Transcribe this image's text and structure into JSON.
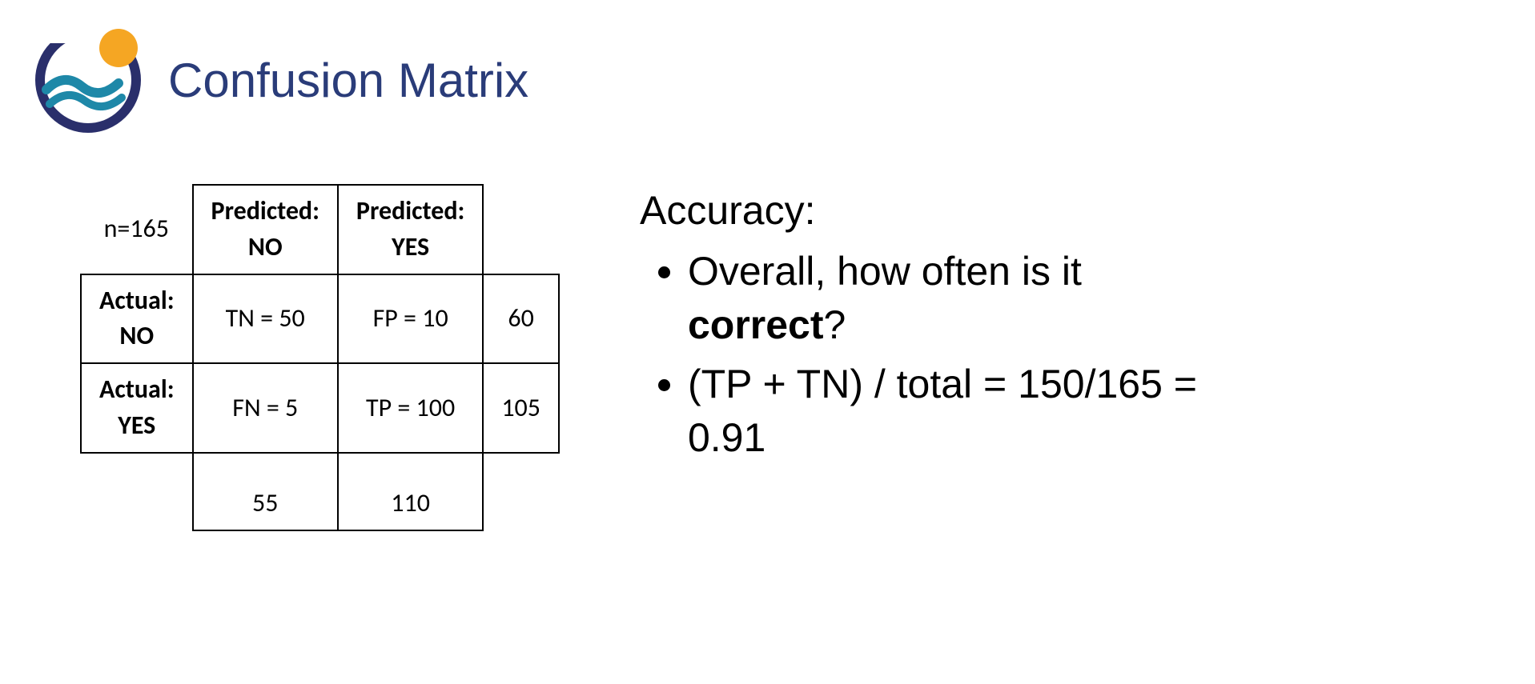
{
  "title": "Confusion Matrix",
  "matrix": {
    "n_label": "n=165",
    "header_pred_no_line1": "Predicted:",
    "header_pred_no_line2": "NO",
    "header_pred_yes_line1": "Predicted:",
    "header_pred_yes_line2": "YES",
    "row1_label_line1": "Actual:",
    "row1_label_line2": "NO",
    "row1_predno": "TN = 50",
    "row1_predyes": "FP = 10",
    "row1_total": "60",
    "row2_label_line1": "Actual:",
    "row2_label_line2": "YES",
    "row2_predno": "FN = 5",
    "row2_predyes": "TP = 100",
    "row2_total": "105",
    "col_total_no": "55",
    "col_total_yes": "110"
  },
  "metric": {
    "title": "Accuracy:",
    "bullet1_prefix": "Overall, how often is it ",
    "bullet1_bold": "correct",
    "bullet1_suffix": "?",
    "bullet2": "(TP + TN) / total = 150/165 = 0.91"
  },
  "chart_data": {
    "type": "table",
    "title": "Confusion Matrix",
    "n": 165,
    "rows": [
      "Actual: NO",
      "Actual: YES"
    ],
    "columns": [
      "Predicted: NO",
      "Predicted: YES"
    ],
    "cells": {
      "TN": 50,
      "FP": 10,
      "FN": 5,
      "TP": 100
    },
    "row_totals": [
      60,
      105
    ],
    "col_totals": [
      55,
      110
    ],
    "accuracy": 0.91
  }
}
